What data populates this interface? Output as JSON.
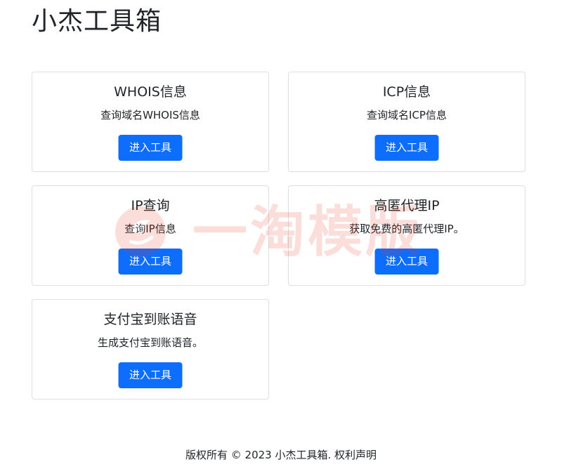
{
  "header": {
    "site_title": "小杰工具箱"
  },
  "cards": [
    {
      "title": "WHOIS信息",
      "description": "查询域名WHOIS信息",
      "button_label": "进入工具"
    },
    {
      "title": "ICP信息",
      "description": "查询域名ICP信息",
      "button_label": "进入工具"
    },
    {
      "title": "IP查询",
      "description": "查询IP信息",
      "button_label": "进入工具"
    },
    {
      "title": "高匿代理IP",
      "description": "获取免费的高匿代理IP。",
      "button_label": "进入工具"
    },
    {
      "title": "支付宝到账语音",
      "description": "生成支付宝到账语音。",
      "button_label": "进入工具"
    }
  ],
  "footer": {
    "copyright": "版权所有 © 2023 小杰工具箱. 权利声明"
  },
  "watermark": {
    "text": "一淘模版",
    "color": "#e8331c"
  },
  "colors": {
    "primary_button": "#0d6efd",
    "card_border": "#dcdfe3"
  }
}
